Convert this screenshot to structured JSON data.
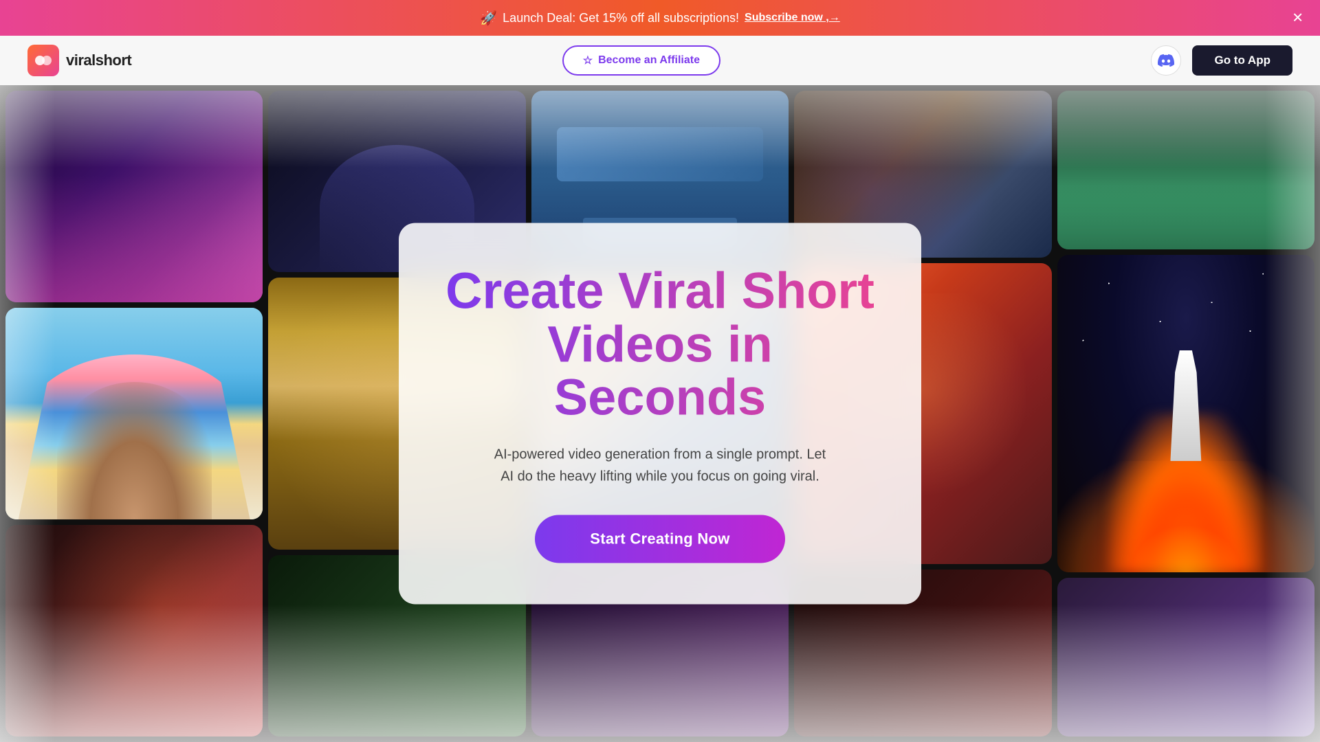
{
  "banner": {
    "text": "Launch Deal: Get 15% off all subscriptions!",
    "link_text": "Subscribe now ,",
    "arrow": "→",
    "icon": "🚀"
  },
  "navbar": {
    "logo_name": "viralshort",
    "affiliate_btn": "Become an Affiliate",
    "affiliate_icon": "☆",
    "discord_icon": "💬",
    "go_to_app": "Go to App"
  },
  "hero": {
    "title_line1": "Create Viral Short",
    "title_line2": "Videos in Seconds",
    "subtitle": "AI-powered video generation from a single prompt. Let AI do the heavy lifting while you focus on going viral.",
    "cta": "Start Creating Now"
  },
  "colors": {
    "banner_gradient_start": "#e84393",
    "banner_gradient_end": "#f05a28",
    "hero_gradient_start": "#7c3aed",
    "hero_gradient_end": "#e84393",
    "cta_gradient_start": "#7c3aed",
    "cta_gradient_end": "#c026d3",
    "go_to_app_bg": "#1a1a2e"
  }
}
